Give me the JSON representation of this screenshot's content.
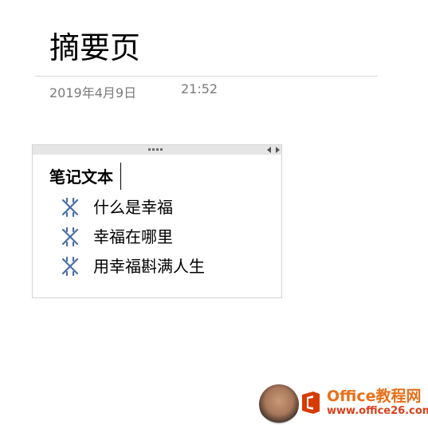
{
  "page": {
    "title": "摘要页",
    "date": "2019年4月9日",
    "time": "21:52"
  },
  "note": {
    "heading": "笔记文本",
    "items": [
      {
        "label": "什么是幸福",
        "icon": "cross-star-icon"
      },
      {
        "label": "幸福在哪里",
        "icon": "cross-star-icon"
      },
      {
        "label": "用幸福斟满人生",
        "icon": "cross-star-icon"
      }
    ],
    "icon_color": "#4a6fa5"
  },
  "watermark": {
    "brand": "Office教程网",
    "url": "www.office26.com",
    "brand_color": "#e8701a"
  }
}
